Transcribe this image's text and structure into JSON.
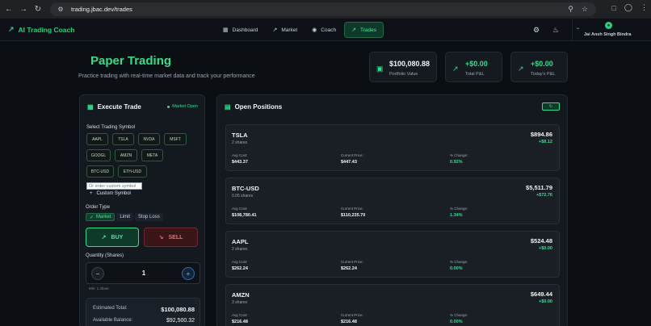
{
  "browser": {
    "url": "trading.jbac.dev/trades"
  },
  "app": {
    "brand": "AI Trading Coach",
    "nav": [
      {
        "label": "Dashboard",
        "icon": "grid-icon"
      },
      {
        "label": "Market",
        "icon": "trend-icon"
      },
      {
        "label": "Coach",
        "icon": "pin-icon"
      },
      {
        "label": "Trades",
        "icon": "trend-icon",
        "active": true
      }
    ],
    "user_name": "Jai Ansh Singh Bindra"
  },
  "page": {
    "title": "Paper Trading",
    "subtitle": "Practice trading with real-time market data and track your performance",
    "stats": [
      {
        "value": "$100,080.88",
        "label": "Portfolio Value",
        "icon": "wallet-icon"
      },
      {
        "value": "+$0.00",
        "label": "Total P&L",
        "icon": "trend-up-icon"
      },
      {
        "value": "+$0.00",
        "label": "Today's P&L",
        "icon": "trend-up-icon"
      }
    ]
  },
  "execute": {
    "title": "Execute Trade",
    "market_status": "Market Open",
    "select_label": "Select Trading Symbol",
    "symbols": [
      "AAPL",
      "TSLA",
      "NVDA",
      "MSFT",
      "GOOGL",
      "AMZN",
      "META",
      "BTC-USD",
      "ETH-USD"
    ],
    "custom_placeholder": "Or enter custom symbol",
    "custom_symbol_label": "Custom Symbol",
    "order_type_label": "Order Type",
    "order_types": [
      "Market",
      "Limit",
      "Stop Loss"
    ],
    "buy_label": "BUY",
    "sell_label": "SELL",
    "quantity_label": "Quantity (Shares)",
    "quantity": "1",
    "quantity_hint": "Min: 1 share",
    "estimated_total_label": "Estimated Total:",
    "estimated_total": "$100,080.88",
    "available_balance_label": "Available Balance:",
    "available_balance": "$92,500.32"
  },
  "positions": {
    "title": "Open Positions",
    "col_labels": {
      "avg": "Avg Cost:",
      "current": "Current Price:",
      "change": "% Change:"
    },
    "items": [
      {
        "symbol": "TSLA",
        "shares": "2 shares",
        "value": "$894.86",
        "pnl": "+$8.12",
        "avg": "$443.37",
        "current": "$447.43",
        "change": "0.92%"
      },
      {
        "symbol": "BTC-USD",
        "shares": "0.05 shares",
        "value": "$5,511.79",
        "pnl": "+$72.76",
        "avg": "$108,780.41",
        "current": "$110,235.70",
        "change": "1.34%"
      },
      {
        "symbol": "AAPL",
        "shares": "2 shares",
        "value": "$524.48",
        "pnl": "+$0.00",
        "avg": "$262.24",
        "current": "$262.24",
        "change": "0.00%"
      },
      {
        "symbol": "AMZN",
        "shares": "3 shares",
        "value": "$649.44",
        "pnl": "+$0.00",
        "avg": "$216.48",
        "current": "$216.48",
        "change": "0.00%"
      }
    ]
  }
}
